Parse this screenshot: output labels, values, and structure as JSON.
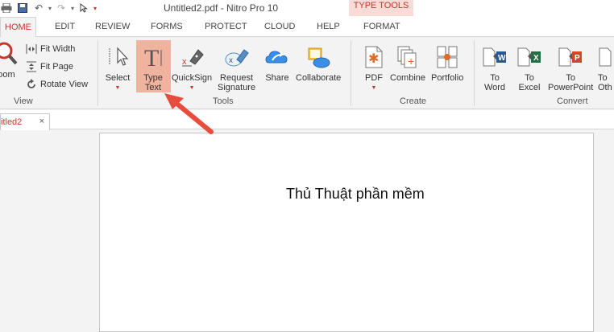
{
  "window": {
    "title": "Untitled2.pdf - Nitro Pro 10",
    "context_tab_group": "TYPE TOOLS"
  },
  "quick_access": {
    "icons": [
      "print-icon",
      "save-icon",
      "undo-icon",
      "redo-icon",
      "select-icon"
    ]
  },
  "tabs": [
    {
      "label": "HOME"
    },
    {
      "label": "EDIT"
    },
    {
      "label": "REVIEW"
    },
    {
      "label": "FORMS"
    },
    {
      "label": "PROTECT"
    },
    {
      "label": "CLOUD"
    },
    {
      "label": "HELP"
    },
    {
      "label": "FORMAT"
    }
  ],
  "ribbon": {
    "view": {
      "zoom_label": "oom",
      "fit_width": "Fit Width",
      "fit_page": "Fit Page",
      "rotate_view": "Rotate View",
      "group_label": "View"
    },
    "tools": {
      "select": "Select",
      "type_text_line1": "Type",
      "type_text_line2": "Text",
      "quicksign": "QuickSign",
      "request_signature_line1": "Request",
      "request_signature_line2": "Signature",
      "share": "Share",
      "collaborate": "Collaborate",
      "group_label": "Tools"
    },
    "create": {
      "pdf": "PDF",
      "combine": "Combine",
      "portfolio": "Portfolio",
      "group_label": "Create"
    },
    "convert": {
      "to_word_line1": "To",
      "to_word_line2": "Word",
      "to_excel_line1": "To",
      "to_excel_line2": "Excel",
      "to_powerpoint_line1": "To",
      "to_powerpoint_line2": "PowerPoint",
      "to_other_line1": "To",
      "to_other_line2": "Oth",
      "group_label": "Convert"
    }
  },
  "document_tab": {
    "label": "itled2",
    "close": "×"
  },
  "document": {
    "text": "Thủ Thuật phần mềm"
  },
  "colors": {
    "accent": "#c0392b",
    "highlight": "#f0b39f",
    "context_band": "#f9dbd7",
    "arrow": "#e74c3c"
  }
}
